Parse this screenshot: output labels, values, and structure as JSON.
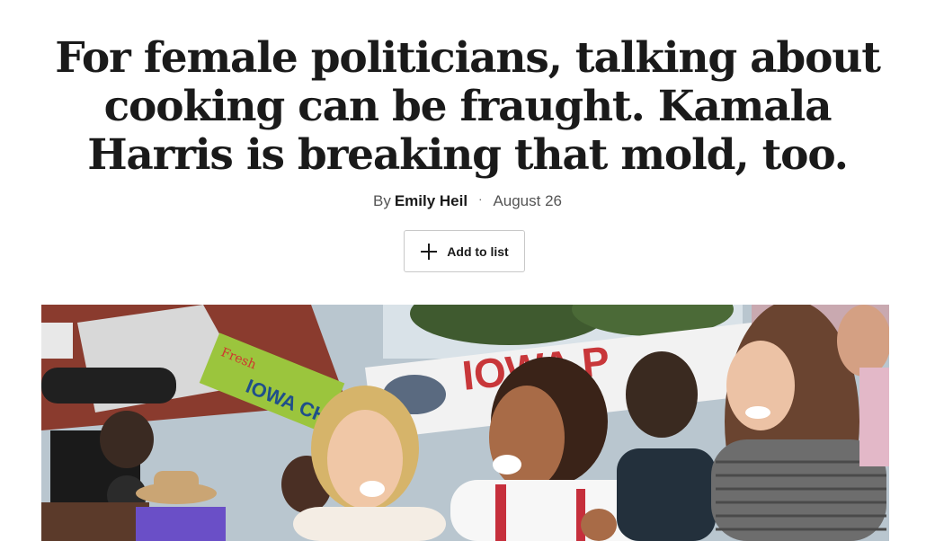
{
  "article": {
    "headline": "For female politicians, talking about cooking can be fraught. Kamala Harris is breaking that mold, too.",
    "byline_prefix": "By",
    "author": "Emily Heil",
    "separator": "·",
    "date": "August 26"
  },
  "actions": {
    "add_to_list_label": "Add to list",
    "add_icon": "plus-icon"
  },
  "hero_image": {
    "sign_text": "IOWA P",
    "stand_sign_text": "IOWA CHO",
    "stand_sign_script": "Fresh"
  }
}
